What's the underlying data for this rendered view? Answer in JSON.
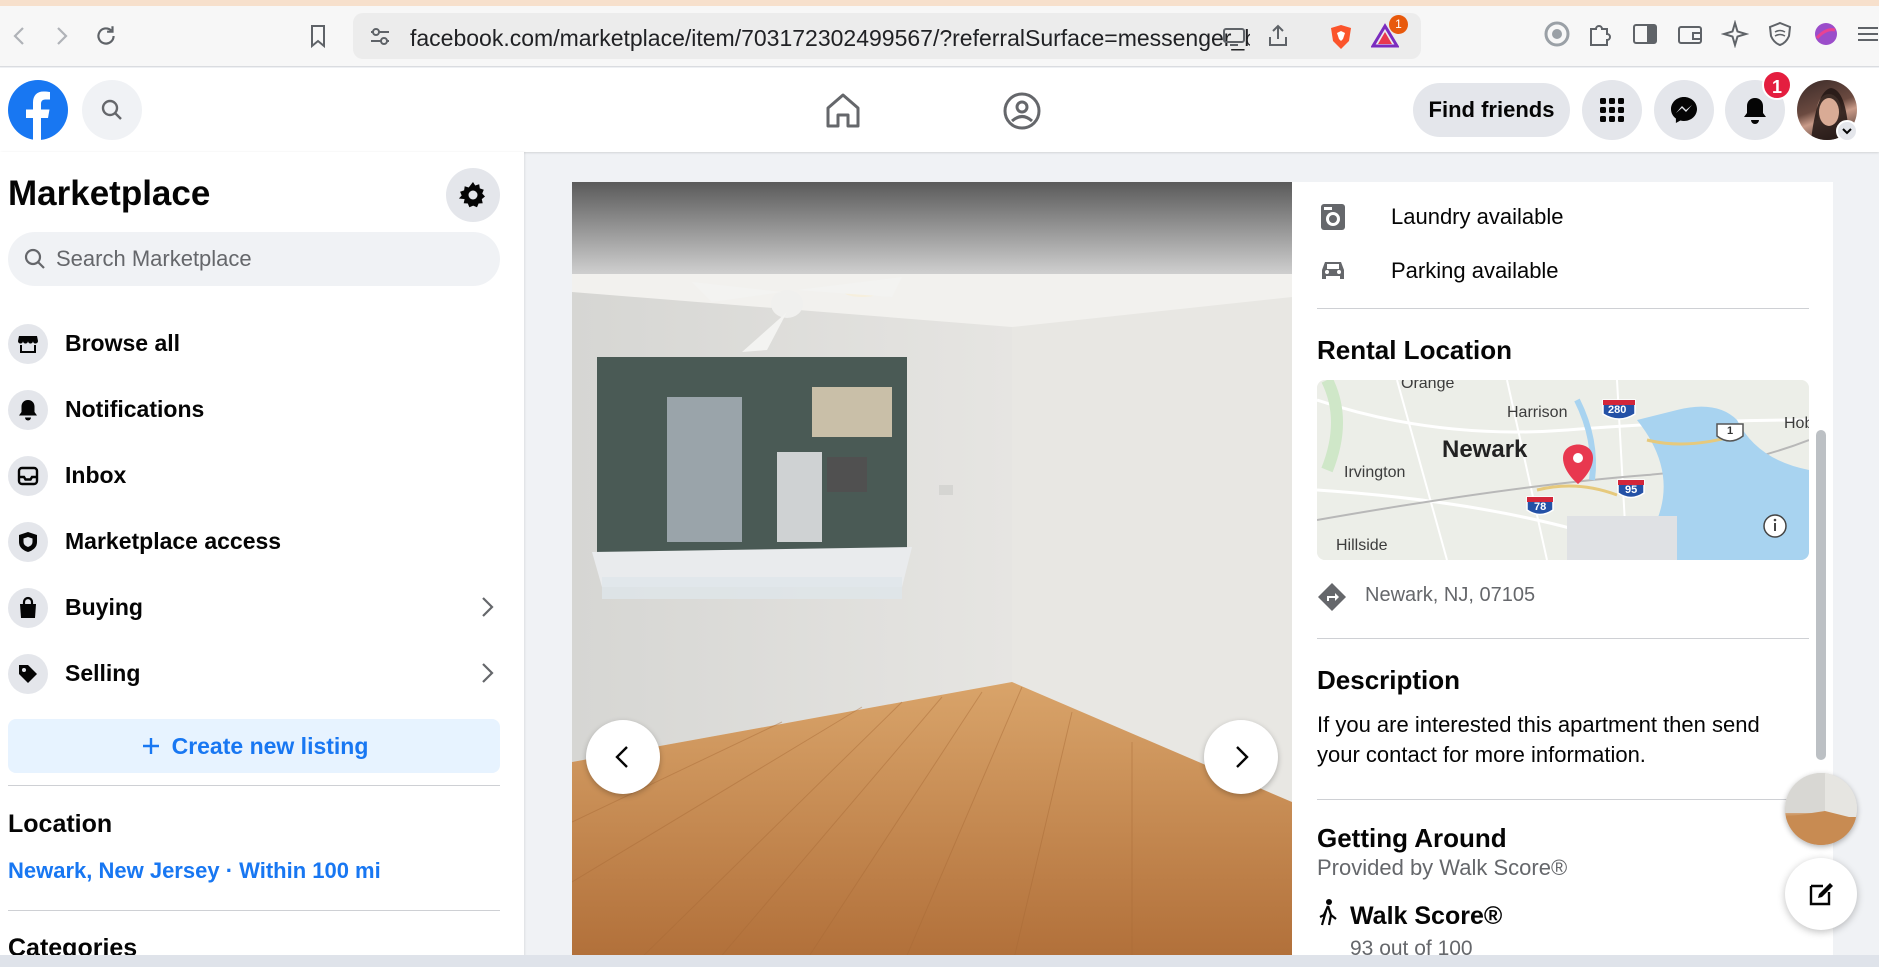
{
  "browser": {
    "url": "facebook.com/marketplace/item/703172302499567/?referralSurface=messenger_b...",
    "extension_badge": "1"
  },
  "header": {
    "find_friends_label": "Find friends",
    "notification_count": "1"
  },
  "sidebar": {
    "title": "Marketplace",
    "search_placeholder": "Search Marketplace",
    "items": [
      {
        "label": "Browse all",
        "icon": "storefront-icon"
      },
      {
        "label": "Notifications",
        "icon": "bell-icon"
      },
      {
        "label": "Inbox",
        "icon": "inbox-icon"
      },
      {
        "label": "Marketplace access",
        "icon": "shield-icon"
      },
      {
        "label": "Buying",
        "icon": "shopping-bag-icon"
      },
      {
        "label": "Selling",
        "icon": "price-tag-icon"
      }
    ],
    "create_listing_label": "Create new listing",
    "location_title": "Location",
    "location_value": "Newark, New Jersey · Within 100 mi",
    "categories_title": "Categories"
  },
  "listing": {
    "features": [
      {
        "label": "Laundry available",
        "icon": "washer-icon"
      },
      {
        "label": "Parking available",
        "icon": "car-icon"
      }
    ],
    "rental_location_title": "Rental Location",
    "map_labels": {
      "city": "Newark",
      "orange": "Orange",
      "harrison": "Harrison",
      "irvington": "Irvington",
      "hillside": "Hillside",
      "hoboken": "Hob",
      "i280": "280",
      "i78": "78",
      "i95": "95",
      "us1": "1"
    },
    "address": "Newark, NJ, 07105",
    "description_title": "Description",
    "description_text": "If you are interested this apartment then send your contact for more information.",
    "getting_around_title": "Getting Around",
    "walk_provider": "Provided by Walk Score®",
    "walk_score_title": "Walk Score®",
    "walk_score_value": "93 out of 100"
  },
  "colors": {
    "facebook_blue": "#1877f2",
    "badge_red": "#e41e3f",
    "map_pin": "#e8384f"
  }
}
